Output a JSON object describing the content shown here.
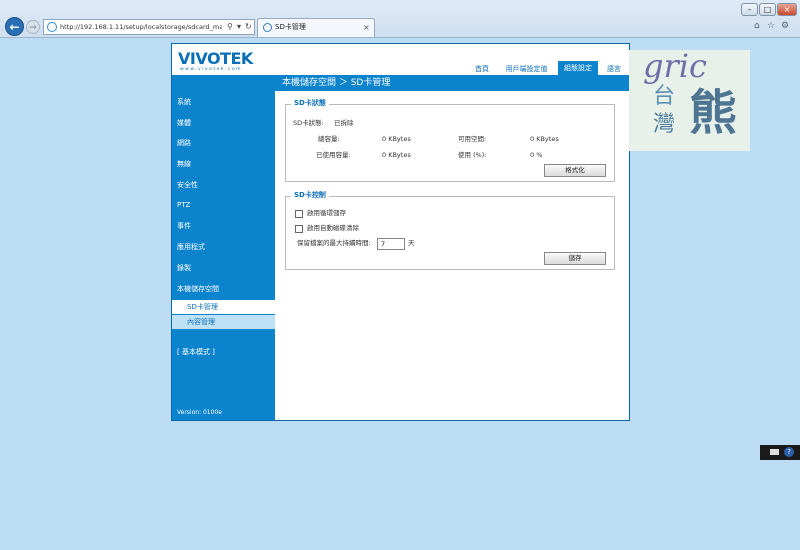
{
  "browser": {
    "address_url": "http://192.168.1.11/setup/localstorage/sdcard_man",
    "search_glyph": "⚲",
    "dropdown_glyph": "▾",
    "refresh_glyph": "↻",
    "tab_title": "SD卡管理",
    "tab_close": "×",
    "window_controls": [
      "–",
      "□",
      "×"
    ],
    "toolbar_icons": [
      "home-icon",
      "star-icon",
      "gear-icon"
    ]
  },
  "brand": {
    "logo_text": "VIVOTEK",
    "logo_tagline": "www.vivotek.com"
  },
  "top_nav": [
    {
      "label": "首頁"
    },
    {
      "label": "用戶端設定值"
    },
    {
      "label": "組態設定",
      "active": true
    },
    {
      "label": "語言"
    }
  ],
  "breadcrumb": "本機儲存空間 ＞ SD卡管理",
  "sidebar": {
    "items": [
      {
        "label": "系統"
      },
      {
        "label": "媒體"
      },
      {
        "label": "網路"
      },
      {
        "label": "無線"
      },
      {
        "label": "安全性"
      },
      {
        "label": "PTZ"
      },
      {
        "label": "事件"
      },
      {
        "label": "應用程式"
      },
      {
        "label": "錄製"
      },
      {
        "label": "本機儲存空間"
      }
    ],
    "subitems": [
      {
        "label": "SD卡管理",
        "selected": true
      },
      {
        "label": "內容管理"
      }
    ],
    "basic_mode": "[ 基本模式 ]",
    "version": "Version: 0100e"
  },
  "sd_status": {
    "title": "SD卡狀態",
    "status_label": "SD卡狀態:",
    "status_value": "已拆除",
    "total_label": "總容量:",
    "total_value": "0 KBytes",
    "free_label": "可用空間:",
    "free_value": "0 KBytes",
    "used_label": "已使用容量:",
    "used_value": "0 KBytes",
    "usage_label": "使用 (%):",
    "usage_value": "0 %",
    "format_button": "格式化"
  },
  "sd_control": {
    "title": "SD卡控制",
    "cyclic_label": "啟用循環儲存",
    "cyclic_checked": false,
    "autoclean_label": "啟用自動磁碟清除",
    "autoclean_checked": false,
    "retention_label": "保留檔案的最大持續時間:",
    "retention_value": "7",
    "retention_unit": "天",
    "save_button": "儲存"
  },
  "watermark": {
    "line1": "gric",
    "line2": "台",
    "line3": "灣",
    "big": "熊"
  },
  "colors": {
    "brand_blue": "#0b83cd",
    "page_background": "#bcdcf4"
  }
}
